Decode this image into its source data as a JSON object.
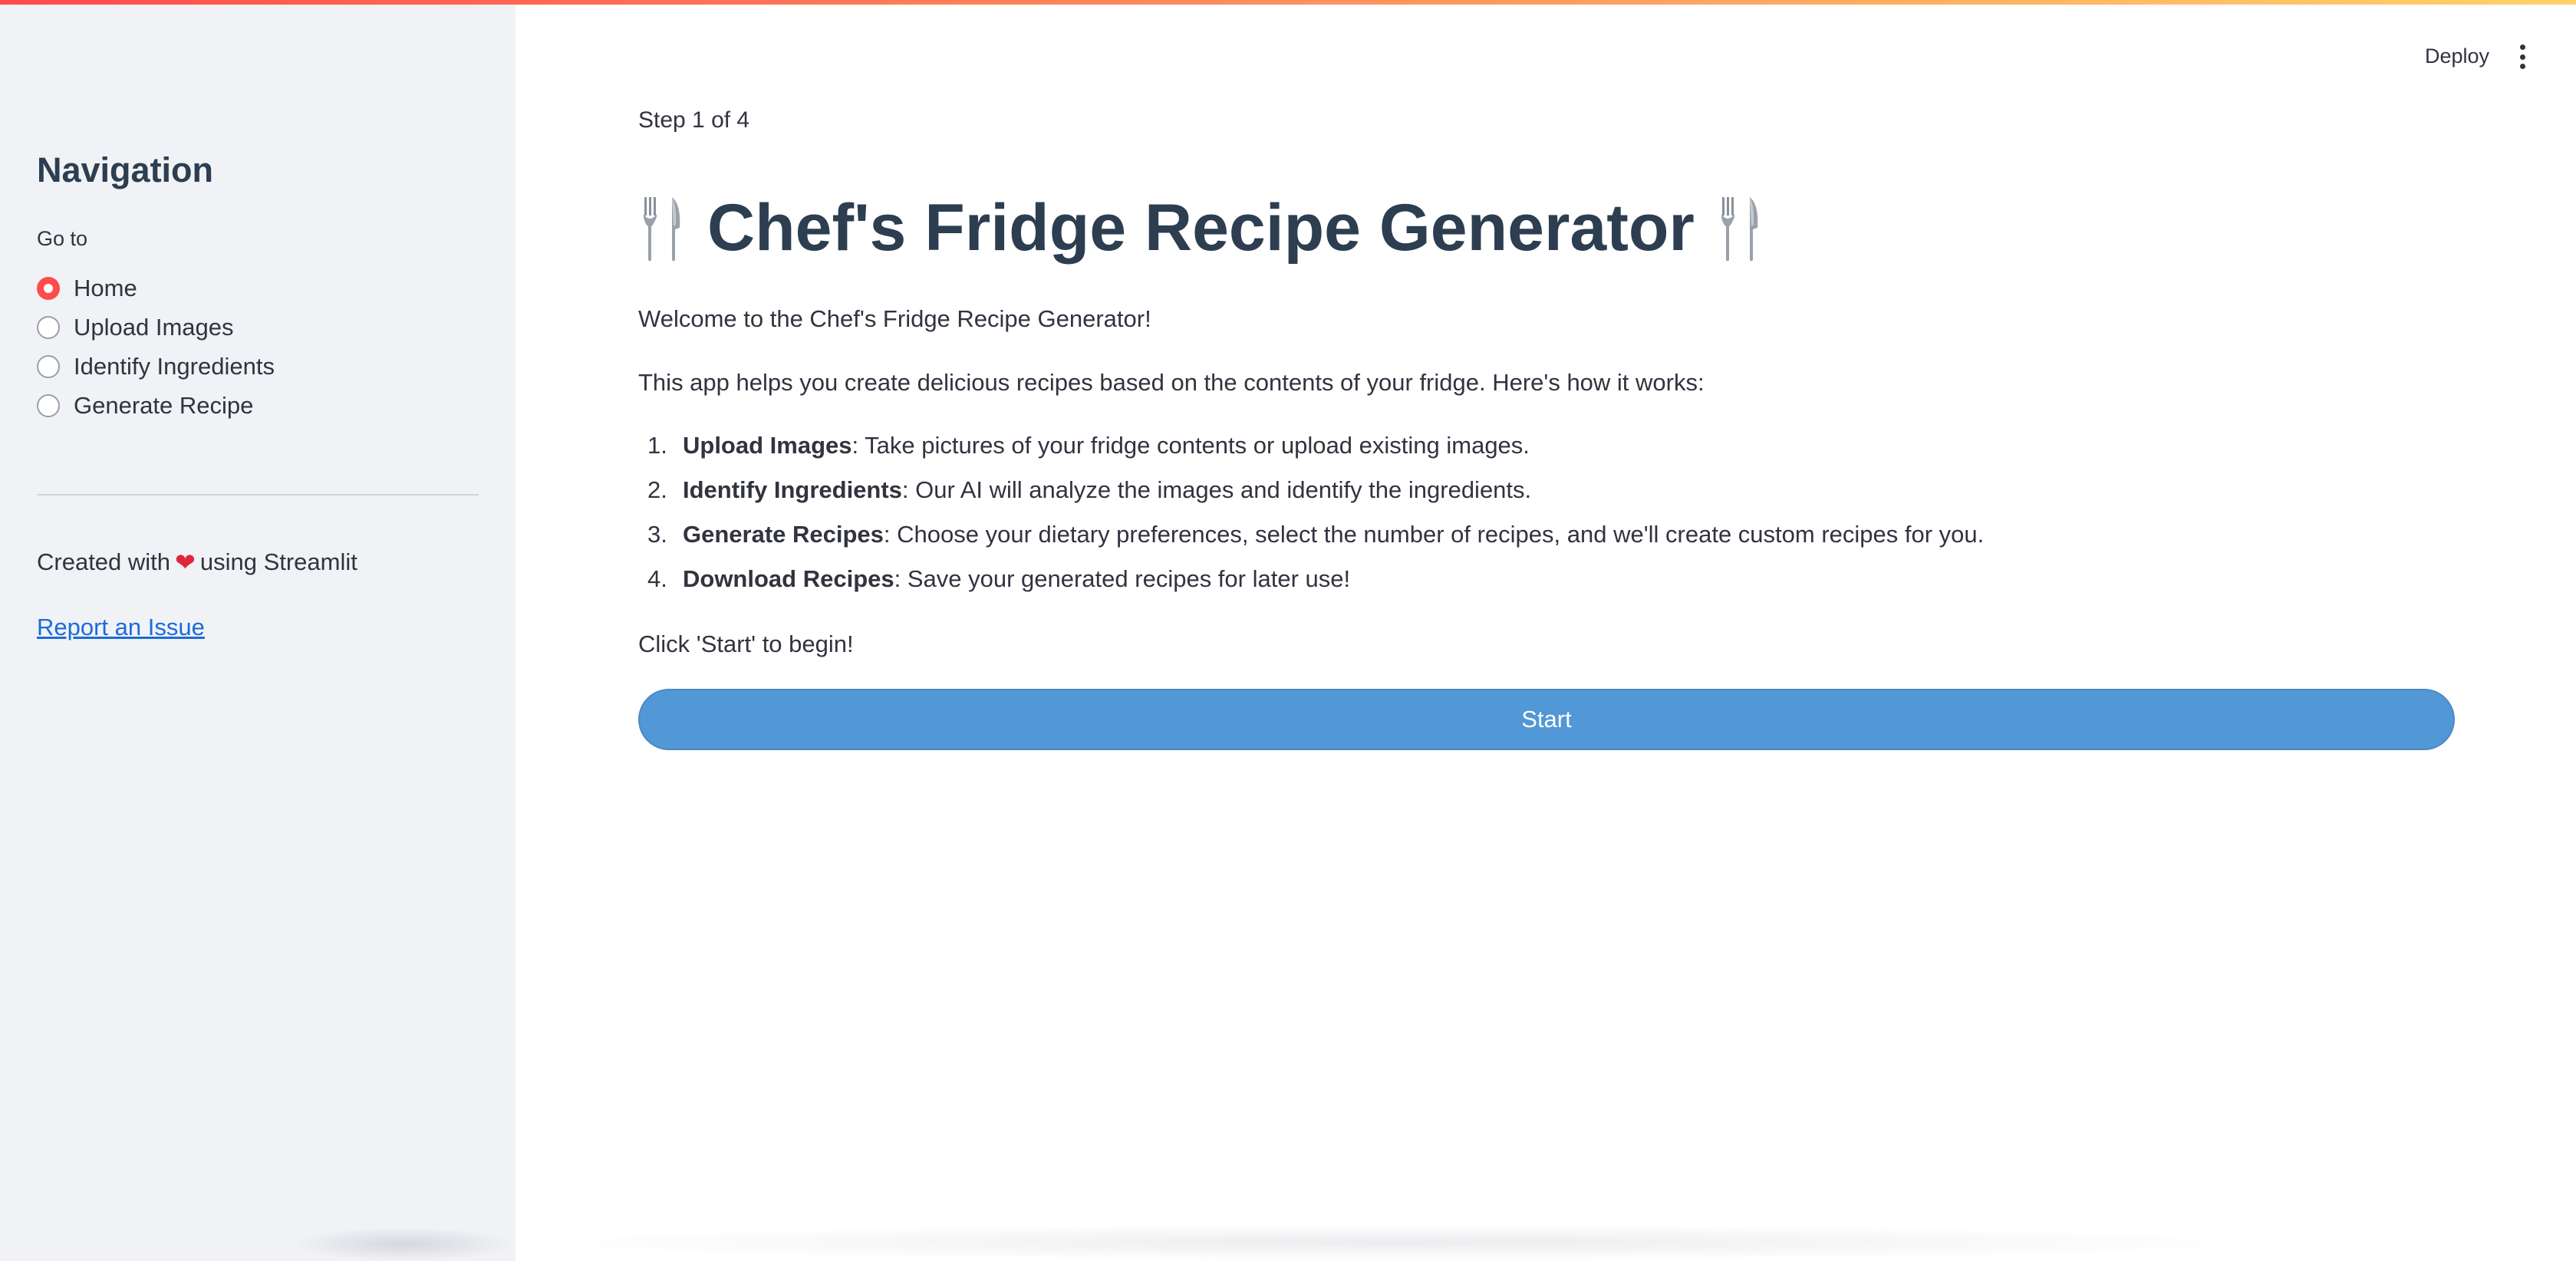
{
  "colors": {
    "accent_red": "#ff4b4b",
    "button_blue": "#5297d6",
    "heading": "#2c3e50",
    "text": "#31333f",
    "link": "#1c6bd8",
    "sidebar_bg": "#f0f2f6"
  },
  "toolbar": {
    "deploy_label": "Deploy",
    "menu_icon": "more-vertical-icon"
  },
  "sidebar": {
    "title": "Navigation",
    "radio_label": "Go to",
    "options": [
      {
        "label": "Home",
        "selected": true
      },
      {
        "label": "Upload Images",
        "selected": false
      },
      {
        "label": "Identify Ingredients",
        "selected": false
      },
      {
        "label": "Generate Recipe",
        "selected": false
      }
    ],
    "created_prefix": "Created with",
    "created_icon": "heart-icon",
    "created_suffix": "using Streamlit",
    "report_link": "Report an Issue"
  },
  "main": {
    "step": "Step 1 of 4",
    "title": "Chef's Fridge Recipe Generator",
    "title_icon": "fork-and-knife-icon",
    "welcome": "Welcome to the Chef's Fridge Recipe Generator!",
    "intro": "This app helps you create delicious recipes based on the contents of your fridge. Here's how it works:",
    "steps": [
      {
        "num": "1.",
        "bold": "Upload Images",
        "text": ": Take pictures of your fridge contents or upload existing images."
      },
      {
        "num": "2.",
        "bold": "Identify Ingredients",
        "text": ": Our AI will analyze the images and identify the ingredients."
      },
      {
        "num": "3.",
        "bold": "Generate Recipes",
        "text": ": Choose your dietary preferences, select the number of recipes, and we'll create custom recipes for you."
      },
      {
        "num": "4.",
        "bold": "Download Recipes",
        "text": ": Save your generated recipes for later use!"
      }
    ],
    "begin": "Click 'Start' to begin!",
    "start_button": "Start"
  }
}
